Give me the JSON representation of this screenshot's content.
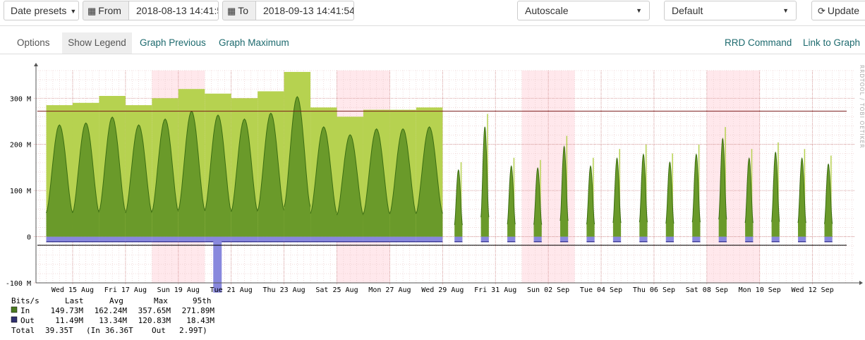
{
  "toolbar": {
    "date_presets": "Date presets",
    "from_label": "From",
    "from_value": "2018-08-13 14:41:5",
    "to_label": "To",
    "to_value": "2018-09-13 14:41:54",
    "scale_select": "Autoscale",
    "theme_select": "Default",
    "update_label": "Update"
  },
  "nav": {
    "options": "Options",
    "show_legend": "Show Legend",
    "graph_previous": "Graph Previous",
    "graph_maximum": "Graph Maximum",
    "rrd_command": "RRD Command",
    "link_to_graph": "Link to Graph"
  },
  "chart_data": {
    "type": "area",
    "watermark": "RRDTOOL / TOBI OETIKER",
    "ylim": [
      -100,
      360
    ],
    "yticks": [
      -100,
      0,
      100,
      200,
      300
    ],
    "ytick_labels": [
      "-100 M",
      "0",
      "100 M",
      "200 M",
      "300 M"
    ],
    "x_start": "2018-08-13 14:41",
    "x_end": "2018-09-13 14:41",
    "xticks": [
      {
        "date": "2018-08-15",
        "label": "Wed 15 Aug"
      },
      {
        "date": "2018-08-17",
        "label": "Fri 17 Aug"
      },
      {
        "date": "2018-08-19",
        "label": "Sun 19 Aug"
      },
      {
        "date": "2018-08-21",
        "label": "Tue 21 Aug"
      },
      {
        "date": "2018-08-23",
        "label": "Thu 23 Aug"
      },
      {
        "date": "2018-08-25",
        "label": "Sat 25 Aug"
      },
      {
        "date": "2018-08-27",
        "label": "Mon 27 Aug"
      },
      {
        "date": "2018-08-29",
        "label": "Wed 29 Aug"
      },
      {
        "date": "2018-08-31",
        "label": "Fri 31 Aug"
      },
      {
        "date": "2018-09-02",
        "label": "Sun 02 Sep"
      },
      {
        "date": "2018-09-04",
        "label": "Tue 04 Sep"
      },
      {
        "date": "2018-09-06",
        "label": "Thu 06 Sep"
      },
      {
        "date": "2018-09-08",
        "label": "Sat 08 Sep"
      },
      {
        "date": "2018-09-10",
        "label": "Mon 10 Sep"
      },
      {
        "date": "2018-09-12",
        "label": "Wed 12 Sep"
      }
    ],
    "daily_in_max": [
      {
        "date": "2018-08-13",
        "value": 0
      },
      {
        "date": "2018-08-14",
        "value": 285
      },
      {
        "date": "2018-08-15",
        "value": 290
      },
      {
        "date": "2018-08-16",
        "value": 305
      },
      {
        "date": "2018-08-17",
        "value": 285
      },
      {
        "date": "2018-08-18",
        "value": 300
      },
      {
        "date": "2018-08-19",
        "value": 320
      },
      {
        "date": "2018-08-20",
        "value": 310
      },
      {
        "date": "2018-08-21",
        "value": 300
      },
      {
        "date": "2018-08-22",
        "value": 315
      },
      {
        "date": "2018-08-23",
        "value": 357
      },
      {
        "date": "2018-08-24",
        "value": 280
      },
      {
        "date": "2018-08-25",
        "value": 260
      },
      {
        "date": "2018-08-26",
        "value": 275
      },
      {
        "date": "2018-08-27",
        "value": 275
      },
      {
        "date": "2018-08-28",
        "value": 280
      },
      {
        "date": "2018-08-29",
        "value": 170
      },
      {
        "date": "2018-08-30",
        "value": 280
      },
      {
        "date": "2018-08-31",
        "value": 180
      },
      {
        "date": "2018-09-01",
        "value": 175
      },
      {
        "date": "2018-09-02",
        "value": 230
      },
      {
        "date": "2018-09-03",
        "value": 180
      },
      {
        "date": "2018-09-04",
        "value": 200
      },
      {
        "date": "2018-09-05",
        "value": 210
      },
      {
        "date": "2018-09-06",
        "value": 190
      },
      {
        "date": "2018-09-07",
        "value": 210
      },
      {
        "date": "2018-09-08",
        "value": 250
      },
      {
        "date": "2018-09-09",
        "value": 200
      },
      {
        "date": "2018-09-10",
        "value": 215
      },
      {
        "date": "2018-09-11",
        "value": 200
      },
      {
        "date": "2018-09-12",
        "value": 185
      }
    ],
    "out_typical": -11,
    "out_spike": {
      "date": "2018-08-20",
      "value": -121
    },
    "percentile_95_in": 271.89,
    "percentile_95_out": -18.43,
    "gap_date": "2018-08-29",
    "colors": {
      "in": "#6a9a2a",
      "in_max": "#b6d250",
      "in_line": "#3b6e12",
      "out": "#8888dd",
      "out_line": "#2a2a8a",
      "pct_in": "#7a1a1a",
      "pct_out": "#000000",
      "weekend": "#ffe8ec"
    },
    "legend": {
      "header": [
        "Bits/s",
        "Last",
        "Avg",
        "Max",
        "95th"
      ],
      "rows": [
        {
          "name": "In",
          "color": "#4a7a20",
          "values": [
            "149.73M",
            "162.24M",
            "357.65M",
            "271.89M"
          ]
        },
        {
          "name": "Out",
          "color": "#303070",
          "values": [
            "11.49M",
            "13.34M",
            "120.83M",
            "18.43M"
          ]
        }
      ],
      "total": {
        "label": "Total",
        "value": "39.35T",
        "in_label": "(In",
        "in_value": "36.36T",
        "out_label": "Out",
        "out_value": "2.99T)"
      }
    }
  }
}
